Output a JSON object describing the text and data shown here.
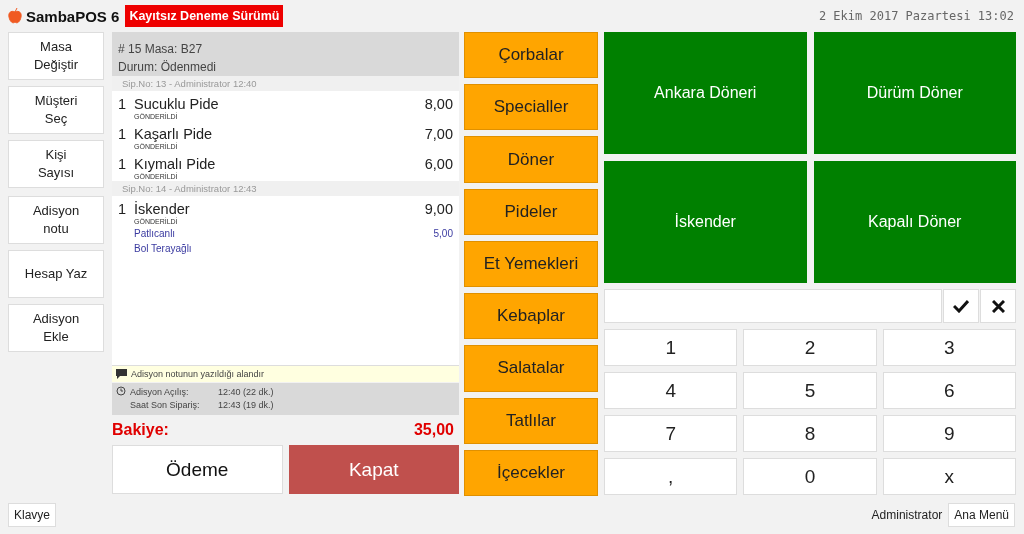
{
  "header": {
    "app_name": "SambaPOS 6",
    "trial_badge": "Kayıtsız Deneme Sürümü",
    "datetime": "2 Ekim 2017 Pazartesi 13:02"
  },
  "left_buttons": [
    "Masa\nDeğiştir",
    "Müşteri\nSeç",
    "Kişi\nSayısı",
    "Adisyon\nnotu",
    "Hesap Yaz",
    "Adisyon\nEkle"
  ],
  "ticket": {
    "title": "# 15 Masa: B27",
    "status": "Durum: Ödenmedi",
    "order_groups": [
      {
        "header": "Sip.No: 13 - Administrator  12:40",
        "items": [
          {
            "quantity": "1",
            "name": "Sucuklu Pide",
            "price": "8,00",
            "state": "GÖNDERİLDİ"
          },
          {
            "quantity": "1",
            "name": "Kaşarlı Pide",
            "price": "7,00",
            "state": "GÖNDERİLDİ"
          },
          {
            "quantity": "1",
            "name": "Kıymalı Pide",
            "price": "6,00",
            "state": "GÖNDERİLDİ"
          }
        ]
      },
      {
        "header": "Sip.No: 14 - Administrator  12:43",
        "items": [
          {
            "quantity": "1",
            "name": "İskender",
            "price": "9,00",
            "state": "GÖNDERİLDİ",
            "modifiers": [
              {
                "name": "Patlıcanlı",
                "price": "5,00"
              },
              {
                "name": "Bol Terayağlı"
              }
            ]
          }
        ]
      }
    ],
    "note": "Adisyon notunun yazıldığı alandır",
    "times": [
      {
        "label": "Adisyon Açılış:",
        "value": "12:40 (22 dk.)"
      },
      {
        "label": "Saat Son Sipariş:",
        "value": "12:43 (19 dk.)"
      }
    ],
    "balance_label": "Bakiye:",
    "balance": "35,00",
    "payment_button": "Ödeme",
    "close_button": "Kapat"
  },
  "categories": [
    "Çorbalar",
    "Specialler",
    "Döner",
    "Pideler",
    "Et Yemekleri",
    "Kebaplar",
    "Salatalar",
    "Tatlılar",
    "İçecekler"
  ],
  "products": [
    "Ankara Döneri",
    "Dürüm Döner",
    "İskender",
    "Kapalı Döner"
  ],
  "numpad": [
    "1",
    "2",
    "3",
    "4",
    "5",
    "6",
    "7",
    "8",
    "9",
    ",",
    "0",
    "x"
  ],
  "footer": {
    "keyboard_button": "Klavye",
    "user": "Administrator",
    "main_menu_button": "Ana Menü"
  }
}
